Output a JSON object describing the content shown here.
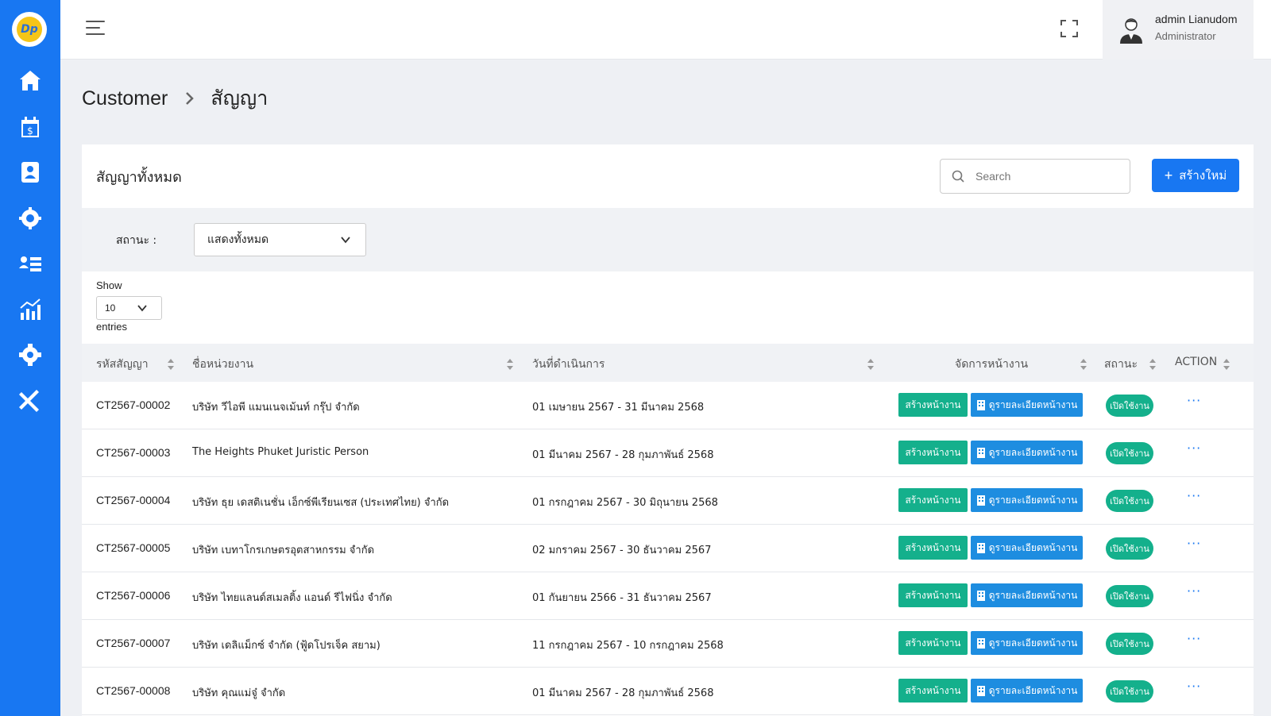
{
  "sidebar": {
    "logo_text": "Dp",
    "items": [
      {
        "icon": "home-icon"
      },
      {
        "icon": "calendar-dollar-icon"
      },
      {
        "icon": "contact-book-icon"
      },
      {
        "icon": "team-gear-icon"
      },
      {
        "icon": "user-list-icon"
      },
      {
        "icon": "chart-icon"
      },
      {
        "icon": "gear-icon"
      },
      {
        "icon": "tools-icon"
      }
    ]
  },
  "header": {
    "user_name": "admin Lianudom",
    "user_role": "Administrator"
  },
  "breadcrumb": {
    "parent": "Customer",
    "current": "สัญญา"
  },
  "card": {
    "title": "สัญญาทั้งหมด",
    "search_placeholder": "Search",
    "new_button": "สร้างใหม่",
    "new_button_plus": "+",
    "filter_label": "สถานะ :",
    "filter_value": "แสดงทั้งหมด",
    "show_label": "Show",
    "show_value": "10",
    "entries_label": "entries"
  },
  "table": {
    "headers": {
      "code": "รหัสสัญญา",
      "name": "ชื่อหน่วยงาน",
      "date": "วันที่ดำเนินการ",
      "manage": "จัดการหน้างาน",
      "status": "สถานะ",
      "action": "ACTION"
    },
    "create_label": "สร้างหน้างาน",
    "detail_label": "ดูรายละเอียดหน้างาน",
    "rows": [
      {
        "code": "CT2567-00002",
        "name": "บริษัท วีไอพี แมนเนจเม้นท์ กรุ๊ป จำกัด",
        "date": "01 เมษายน 2567 - 31 มีนาคม 2568",
        "status": "เปิดใช้งาน",
        "action": "···"
      },
      {
        "code": "CT2567-00003",
        "name": "The Heights Phuket Juristic Person",
        "date": "01 มีนาคม 2567 - 28 กุมภาพันธ์ 2568",
        "status": "เปิดใช้งาน",
        "action": "···"
      },
      {
        "code": "CT2567-00004",
        "name": "บริษัท ธุย เดสติเนชั่น เอ็กซ์พีเรียนเซส (ประเทศไทย) จำกัด",
        "date": "01 กรกฎาคม 2567 - 30 มิถุนายน 2568",
        "status": "เปิดใช้งาน",
        "action": "···"
      },
      {
        "code": "CT2567-00005",
        "name": "บริษัท เบทาโกรเกษตรอุตสาหกรรม จำกัด",
        "date": "02 มกราคม 2567 - 30 ธันวาคม 2567",
        "status": "เปิดใช้งาน",
        "action": "···"
      },
      {
        "code": "CT2567-00006",
        "name": "บริษัท ไทยแลนด์สเมลติ้ง แอนด์ รีไฟนิ่ง จำกัด",
        "date": "01 กันยายน 2566 - 31 ธันวาคม 2567",
        "status": "เปิดใช้งาน",
        "action": "···"
      },
      {
        "code": "CT2567-00007",
        "name": "บริษัท เดลิแม็กซ์ จำกัด (ฟู้ดโปรเจ็ค สยาม)",
        "date": "11 กรกฎาคม 2567 - 10 กรกฎาคม 2568",
        "status": "เปิดใช้งาน",
        "action": "···"
      },
      {
        "code": "CT2567-00008",
        "name": "บริษัท คุณแม่จู๋ จำกัด",
        "date": "01 มีนาคม 2567 - 28 กุมภาพันธ์ 2568",
        "status": "เปิดใช้งาน",
        "action": "···"
      }
    ]
  },
  "colors": {
    "primary": "#1877f2",
    "success": "#14b08c",
    "info": "#1e8de0"
  }
}
